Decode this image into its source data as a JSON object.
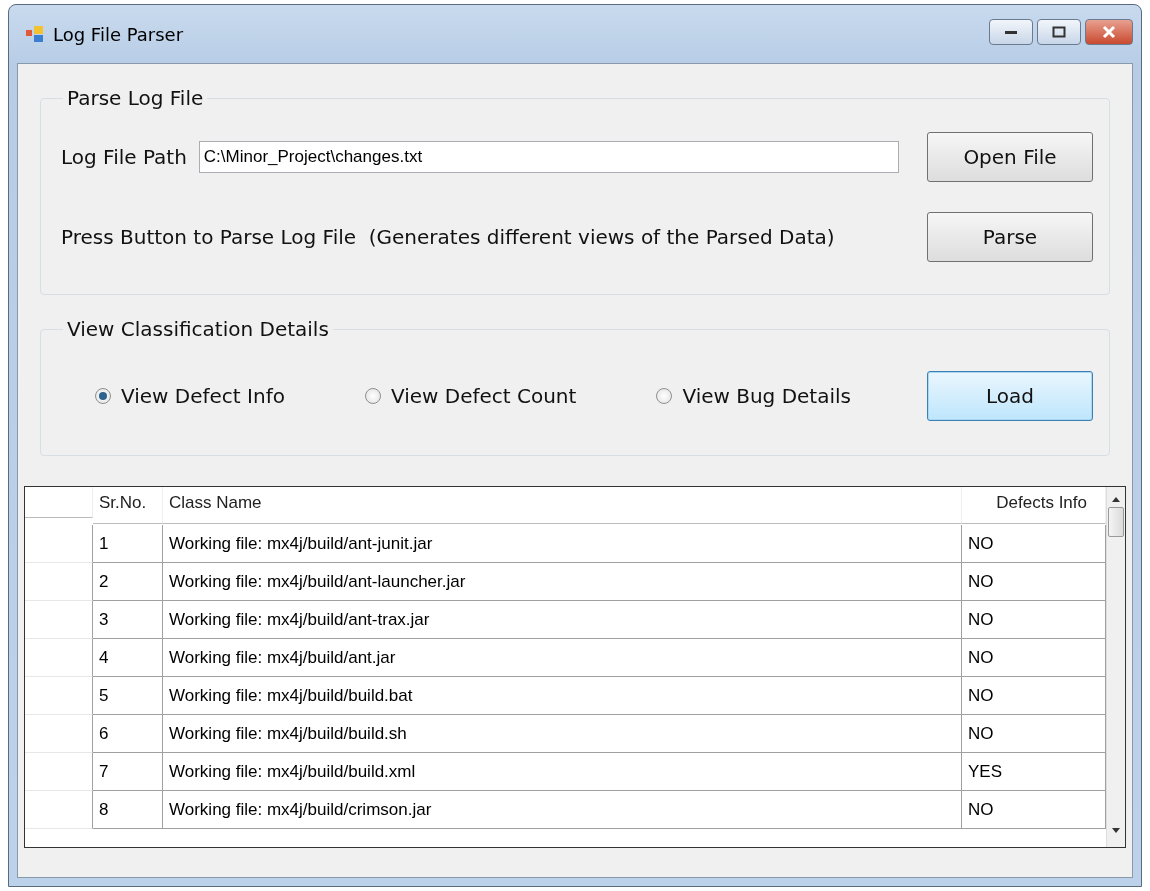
{
  "window": {
    "title": "Log File Parser"
  },
  "parse_group": {
    "title": "Parse Log File",
    "path_label": "Log File Path",
    "path_value": "C:\\Minor_Project\\changes.txt",
    "open_button": "Open File",
    "parse_hint": "Press Button to Parse Log File  (Generates different views of the Parsed Data)",
    "parse_button": "Parse"
  },
  "view_group": {
    "title": "View Classification Details",
    "options": [
      {
        "label": "View Defect Info",
        "selected": true
      },
      {
        "label": "View Defect Count",
        "selected": false
      },
      {
        "label": "View Bug Details",
        "selected": false
      }
    ],
    "load_button": "Load"
  },
  "table": {
    "columns": [
      "Sr.No.",
      "Class Name",
      "Defects Info"
    ],
    "rows": [
      [
        "1",
        "Working file: mx4j/build/ant-junit.jar",
        "NO"
      ],
      [
        "2",
        "Working file: mx4j/build/ant-launcher.jar",
        "NO"
      ],
      [
        "3",
        "Working file: mx4j/build/ant-trax.jar",
        "NO"
      ],
      [
        "4",
        "Working file: mx4j/build/ant.jar",
        "NO"
      ],
      [
        "5",
        "Working file: mx4j/build/build.bat",
        "NO"
      ],
      [
        "6",
        "Working file: mx4j/build/build.sh",
        "NO"
      ],
      [
        "7",
        "Working file: mx4j/build/build.xml",
        "YES"
      ],
      [
        "8",
        "Working file: mx4j/build/crimson.jar",
        "NO"
      ]
    ]
  }
}
